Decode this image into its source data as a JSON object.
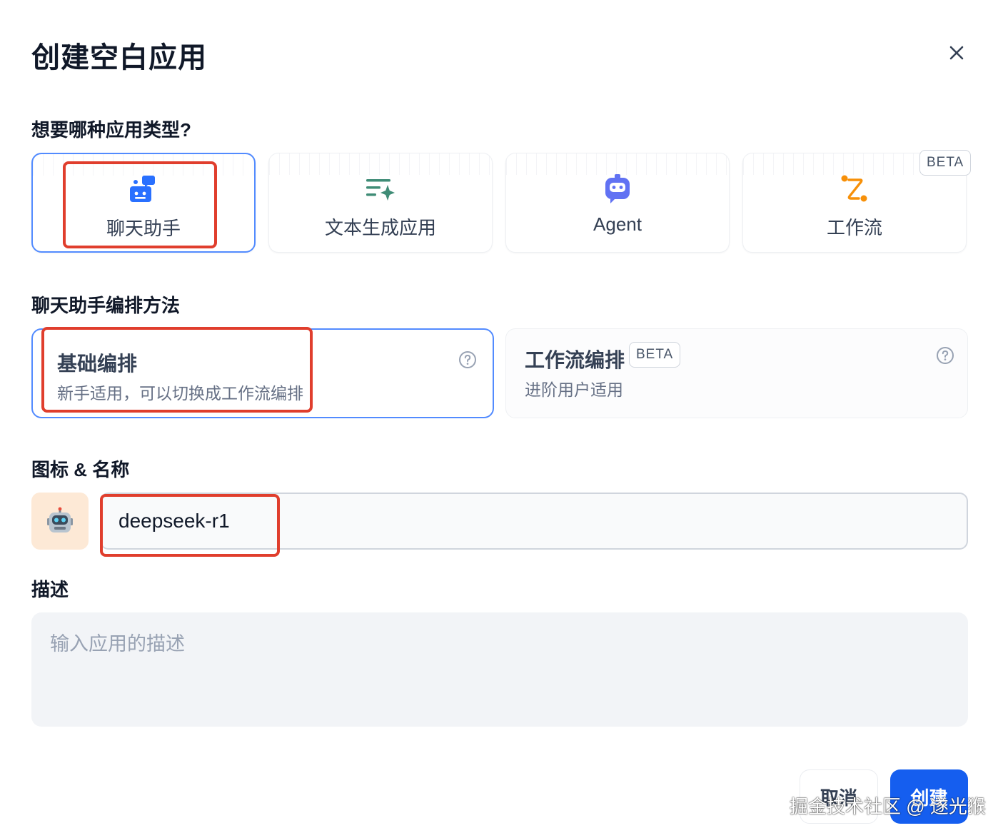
{
  "dialog": {
    "title": "创建空白应用",
    "close_icon": "close-icon"
  },
  "app_type": {
    "section_label": "想要哪种应用类型?",
    "cards": [
      {
        "label": "聊天助手",
        "icon": "chat-bot-icon",
        "color": "#2970ff",
        "selected": true
      },
      {
        "label": "文本生成应用",
        "icon": "text-generation-icon",
        "color": "#3f8c76",
        "selected": false
      },
      {
        "label": "Agent",
        "icon": "agent-robot-icon",
        "color": "#6172f3",
        "selected": false
      },
      {
        "label": "工作流",
        "icon": "workflow-icon",
        "color": "#f79009",
        "selected": false,
        "badge": "BETA"
      }
    ]
  },
  "orchestration": {
    "section_label": "聊天助手编排方法",
    "options": [
      {
        "title": "基础编排",
        "description": "新手适用，可以切换成工作流编排",
        "selected": true,
        "help_icon": "help-circle-icon"
      },
      {
        "title": "工作流编排",
        "badge": "BETA",
        "description": "进阶用户适用",
        "selected": false,
        "help_icon": "help-circle-icon"
      }
    ]
  },
  "icon_name": {
    "section_label": "图标 & 名称",
    "app_icon": "robot-emoji-icon",
    "app_icon_bg": "#fde9d6",
    "name_value": "deepseek-r1"
  },
  "description": {
    "section_label": "描述",
    "placeholder": "输入应用的描述"
  },
  "footer": {
    "cancel_label": "取消",
    "create_label": "创建"
  },
  "watermark": "掘金技术社区 @ 遂光猴",
  "colors": {
    "accent": "#155eef",
    "selected_border": "#528bff",
    "highlight_box": "#e03e2d"
  }
}
